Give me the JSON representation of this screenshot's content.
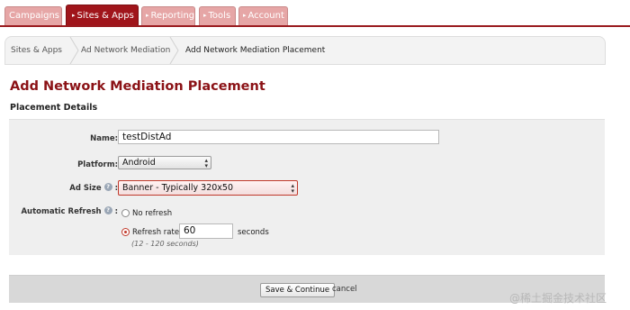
{
  "nav": {
    "tabs": [
      {
        "label": "Campaigns",
        "active": false,
        "arrow": false
      },
      {
        "label": "Sites & Apps",
        "active": true,
        "arrow": true
      },
      {
        "label": "Reporting",
        "active": false,
        "arrow": true
      },
      {
        "label": "Tools",
        "active": false,
        "arrow": true
      },
      {
        "label": "Account",
        "active": false,
        "arrow": true
      }
    ],
    "arrow_glyph": "▸"
  },
  "breadcrumb": [
    "Sites & Apps",
    "Ad Network Mediation",
    "Add Network Mediation Placement"
  ],
  "page_title": "Add Network Mediation Placement",
  "section_title": "Placement Details",
  "form": {
    "name_label": "Name:",
    "name_value": "testDistAd",
    "platform_label": "Platform:",
    "platform_value": "Android",
    "ad_size_label": "Ad Size",
    "ad_size_value": "Banner - Typically 320x50",
    "auto_refresh_label": "Automatic Refresh",
    "colon": ":",
    "help_glyph": "?",
    "no_refresh_label": "No refresh",
    "refresh_rate_label": "Refresh rate:",
    "refresh_rate_value": "60",
    "seconds_label": "seconds",
    "range_hint": "(12 - 120 seconds)",
    "selected_option": "refresh_rate"
  },
  "footer": {
    "save_label": "Save & Continue",
    "cancel_label": "cancel"
  },
  "watermark": "@稀土掘金技术社区",
  "colors": {
    "brand_red": "#a0151b",
    "tab_inactive": "#e6a6a6",
    "title_red": "#8b1216"
  }
}
